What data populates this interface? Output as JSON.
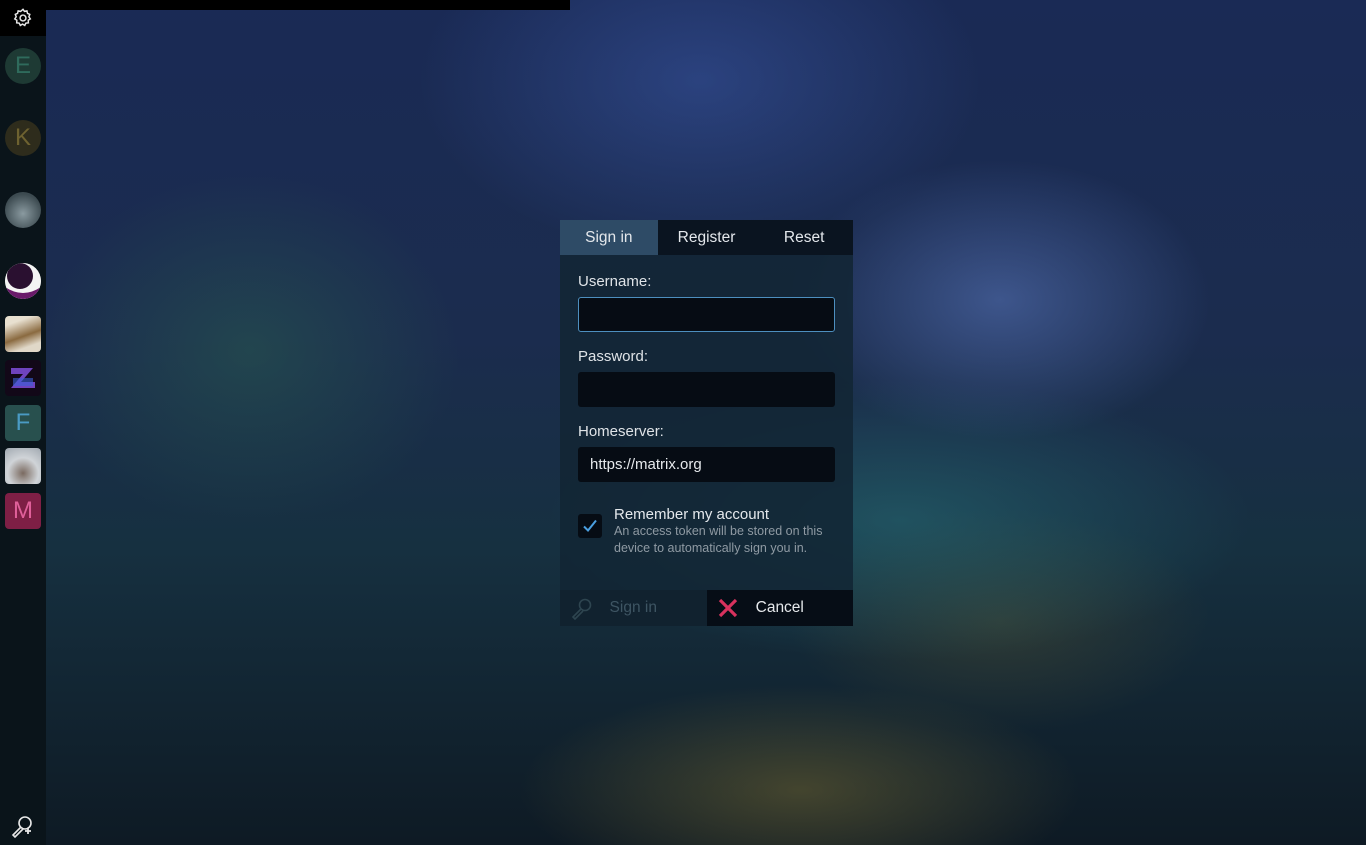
{
  "sidebar": {
    "settings_icon": "gear-icon",
    "rooms": [
      {
        "name": "E",
        "type": "letter",
        "color": "#1e3a34",
        "text_color": "#2f6b5c"
      },
      {
        "name": "K",
        "type": "letter",
        "color": "#2e2c1c",
        "text_color": "#6e6230"
      },
      {
        "name": "",
        "type": "image",
        "desc": "sleeping-animal-avatar"
      },
      {
        "name": "",
        "type": "image",
        "desc": "crescent-moon-avatar"
      },
      {
        "name": "",
        "type": "image",
        "desc": "top-hat-avatar"
      },
      {
        "name": "",
        "type": "image",
        "desc": "pixel-logo-avatar"
      },
      {
        "name": "F",
        "type": "letter",
        "color": "#28504e",
        "text_color": "#4a9bc4"
      },
      {
        "name": "",
        "type": "image",
        "desc": "snow-cave-avatar"
      },
      {
        "name": "M",
        "type": "letter",
        "color": "#7e1f45",
        "text_color": "#e0609a"
      }
    ],
    "add_account_icon": "add-account-key-icon"
  },
  "dialog": {
    "tabs": [
      {
        "label": "Sign in",
        "active": true
      },
      {
        "label": "Register",
        "active": false
      },
      {
        "label": "Reset",
        "active": false
      }
    ],
    "username": {
      "label": "Username:",
      "value": "",
      "placeholder": ""
    },
    "password": {
      "label": "Password:",
      "value": "",
      "placeholder": ""
    },
    "homeserver": {
      "label": "Homeserver:",
      "value": "https://matrix.org"
    },
    "remember": {
      "checked": true,
      "title": "Remember my account",
      "description": "An access token will be stored on this device to automatically sign you in."
    },
    "buttons": {
      "signin_label": "Sign in",
      "signin_icon": "key-icon",
      "cancel_label": "Cancel",
      "cancel_icon": "x-icon"
    }
  }
}
